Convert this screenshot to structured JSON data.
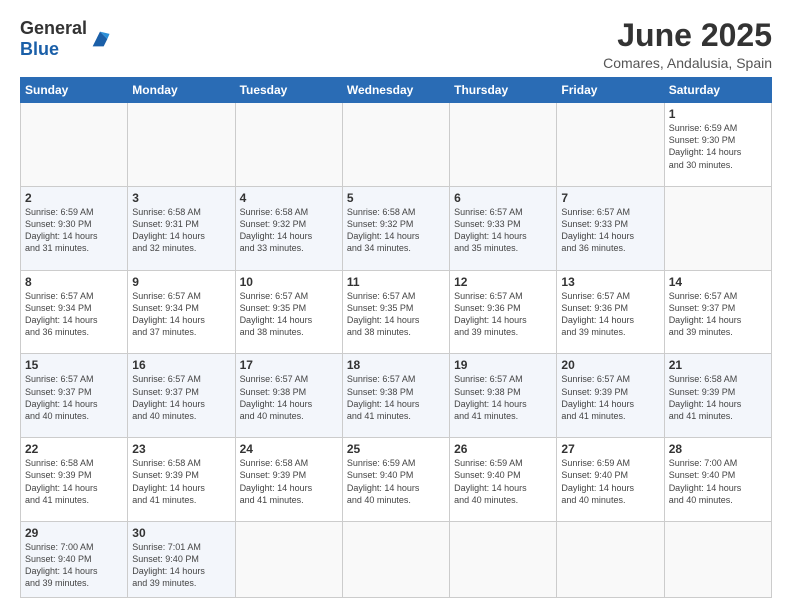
{
  "header": {
    "logo_general": "General",
    "logo_blue": "Blue",
    "title": "June 2025",
    "subtitle": "Comares, Andalusia, Spain"
  },
  "calendar": {
    "days_of_week": [
      "Sunday",
      "Monday",
      "Tuesday",
      "Wednesday",
      "Thursday",
      "Friday",
      "Saturday"
    ],
    "weeks": [
      [
        null,
        null,
        null,
        null,
        null,
        null,
        null
      ]
    ]
  },
  "cells": {
    "w1": [
      {
        "day": null,
        "info": null
      },
      {
        "day": null,
        "info": null
      },
      {
        "day": null,
        "info": null
      },
      {
        "day": null,
        "info": null
      },
      {
        "day": null,
        "info": null
      },
      {
        "day": null,
        "info": null
      },
      {
        "day": "1",
        "info": "Sunrise: 6:59 AM\nSunset: 9:30 PM\nDaylight: 14 hours\nand 30 minutes."
      }
    ],
    "w2": [
      {
        "day": "2",
        "info": "Sunrise: 6:59 AM\nSunset: 9:30 PM\nDaylight: 14 hours\nand 31 minutes."
      },
      {
        "day": "3",
        "info": "Sunrise: 6:58 AM\nSunset: 9:31 PM\nDaylight: 14 hours\nand 32 minutes."
      },
      {
        "day": "4",
        "info": "Sunrise: 6:58 AM\nSunset: 9:32 PM\nDaylight: 14 hours\nand 33 minutes."
      },
      {
        "day": "5",
        "info": "Sunrise: 6:58 AM\nSunset: 9:32 PM\nDaylight: 14 hours\nand 34 minutes."
      },
      {
        "day": "6",
        "info": "Sunrise: 6:57 AM\nSunset: 9:33 PM\nDaylight: 14 hours\nand 35 minutes."
      },
      {
        "day": "7",
        "info": "Sunrise: 6:57 AM\nSunset: 9:33 PM\nDaylight: 14 hours\nand 36 minutes."
      }
    ],
    "w3": [
      {
        "day": "8",
        "info": "Sunrise: 6:57 AM\nSunset: 9:34 PM\nDaylight: 14 hours\nand 36 minutes."
      },
      {
        "day": "9",
        "info": "Sunrise: 6:57 AM\nSunset: 9:34 PM\nDaylight: 14 hours\nand 37 minutes."
      },
      {
        "day": "10",
        "info": "Sunrise: 6:57 AM\nSunset: 9:35 PM\nDaylight: 14 hours\nand 38 minutes."
      },
      {
        "day": "11",
        "info": "Sunrise: 6:57 AM\nSunset: 9:35 PM\nDaylight: 14 hours\nand 38 minutes."
      },
      {
        "day": "12",
        "info": "Sunrise: 6:57 AM\nSunset: 9:36 PM\nDaylight: 14 hours\nand 39 minutes."
      },
      {
        "day": "13",
        "info": "Sunrise: 6:57 AM\nSunset: 9:36 PM\nDaylight: 14 hours\nand 39 minutes."
      },
      {
        "day": "14",
        "info": "Sunrise: 6:57 AM\nSunset: 9:37 PM\nDaylight: 14 hours\nand 39 minutes."
      }
    ],
    "w4": [
      {
        "day": "15",
        "info": "Sunrise: 6:57 AM\nSunset: 9:37 PM\nDaylight: 14 hours\nand 40 minutes."
      },
      {
        "day": "16",
        "info": "Sunrise: 6:57 AM\nSunset: 9:37 PM\nDaylight: 14 hours\nand 40 minutes."
      },
      {
        "day": "17",
        "info": "Sunrise: 6:57 AM\nSunset: 9:38 PM\nDaylight: 14 hours\nand 40 minutes."
      },
      {
        "day": "18",
        "info": "Sunrise: 6:57 AM\nSunset: 9:38 PM\nDaylight: 14 hours\nand 41 minutes."
      },
      {
        "day": "19",
        "info": "Sunrise: 6:57 AM\nSunset: 9:38 PM\nDaylight: 14 hours\nand 41 minutes."
      },
      {
        "day": "20",
        "info": "Sunrise: 6:57 AM\nSunset: 9:39 PM\nDaylight: 14 hours\nand 41 minutes."
      },
      {
        "day": "21",
        "info": "Sunrise: 6:58 AM\nSunset: 9:39 PM\nDaylight: 14 hours\nand 41 minutes."
      }
    ],
    "w5": [
      {
        "day": "22",
        "info": "Sunrise: 6:58 AM\nSunset: 9:39 PM\nDaylight: 14 hours\nand 41 minutes."
      },
      {
        "day": "23",
        "info": "Sunrise: 6:58 AM\nSunset: 9:39 PM\nDaylight: 14 hours\nand 41 minutes."
      },
      {
        "day": "24",
        "info": "Sunrise: 6:58 AM\nSunset: 9:39 PM\nDaylight: 14 hours\nand 41 minutes."
      },
      {
        "day": "25",
        "info": "Sunrise: 6:59 AM\nSunset: 9:40 PM\nDaylight: 14 hours\nand 40 minutes."
      },
      {
        "day": "26",
        "info": "Sunrise: 6:59 AM\nSunset: 9:40 PM\nDaylight: 14 hours\nand 40 minutes."
      },
      {
        "day": "27",
        "info": "Sunrise: 6:59 AM\nSunset: 9:40 PM\nDaylight: 14 hours\nand 40 minutes."
      },
      {
        "day": "28",
        "info": "Sunrise: 7:00 AM\nSunset: 9:40 PM\nDaylight: 14 hours\nand 40 minutes."
      }
    ],
    "w6": [
      {
        "day": "29",
        "info": "Sunrise: 7:00 AM\nSunset: 9:40 PM\nDaylight: 14 hours\nand 39 minutes."
      },
      {
        "day": "30",
        "info": "Sunrise: 7:01 AM\nSunset: 9:40 PM\nDaylight: 14 hours\nand 39 minutes."
      },
      null,
      null,
      null,
      null,
      null
    ]
  }
}
